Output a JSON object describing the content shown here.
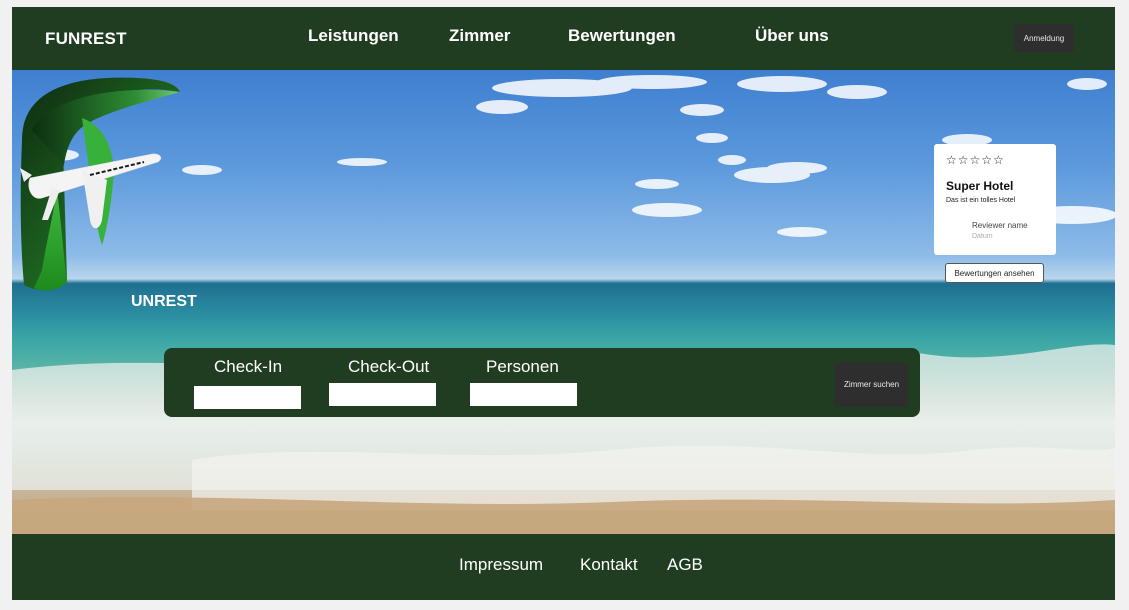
{
  "header": {
    "brand": "FUNREST",
    "nav": [
      "Leistungen",
      "Zimmer",
      "Bewertungen",
      "Über uns"
    ],
    "login_label": "Anmeldung"
  },
  "hero": {
    "logo_text": "UNREST",
    "review": {
      "stars": "☆☆☆☆☆",
      "title": "Super Hotel",
      "text": "Das ist ein tolles Hotel",
      "reviewer": "Reviewer name",
      "date": "Datum"
    },
    "reviews_button": "Bewertungen ansehen"
  },
  "search": {
    "checkin_label": "Check-In",
    "checkout_label": "Check-Out",
    "persons_label": "Personen",
    "button_label": "Zimmer suchen"
  },
  "footer": {
    "links": [
      "Impressum",
      "Kontakt",
      "AGB"
    ]
  },
  "colors": {
    "brand_green": "#213d21",
    "dark_button": "#2e2e2e"
  }
}
